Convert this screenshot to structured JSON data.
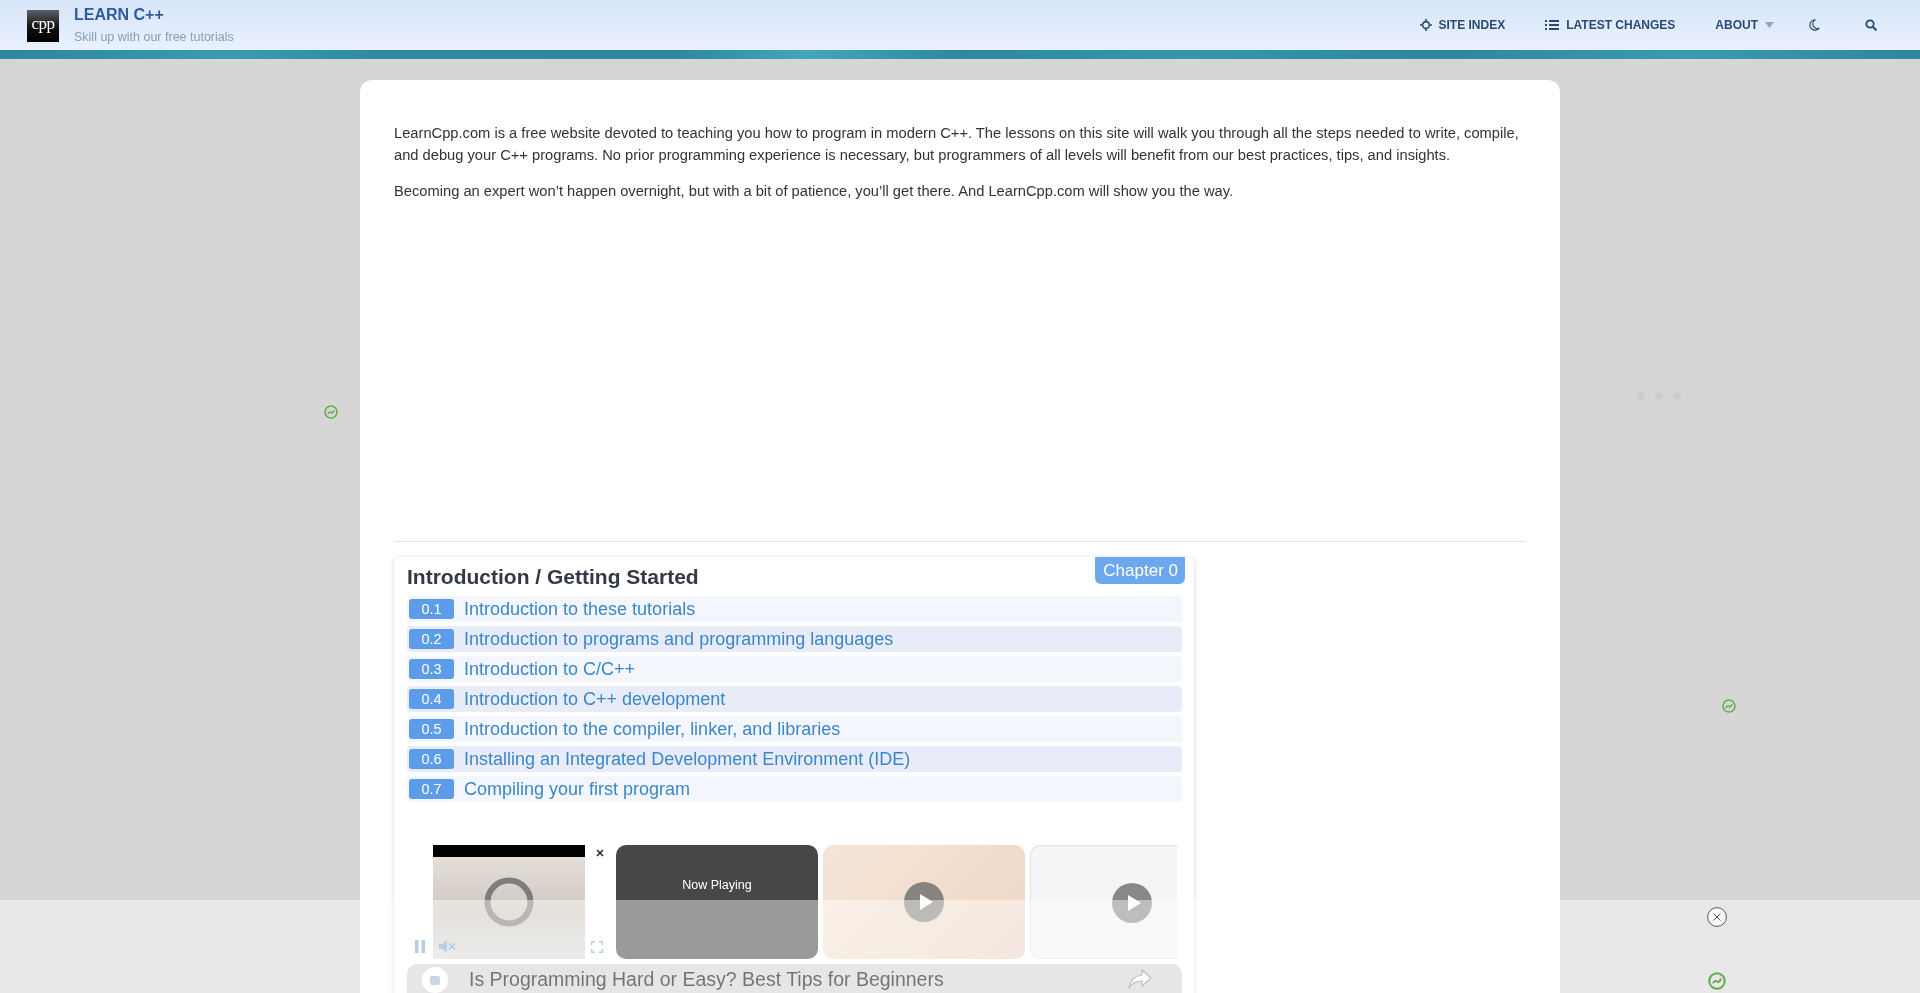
{
  "header": {
    "logo_text": "cpp",
    "title": "LEARN C++",
    "tagline": "Skill up with our free tutorials",
    "nav": [
      {
        "label": "SITE INDEX",
        "kind": "link"
      },
      {
        "label": "LATEST CHANGES",
        "kind": "link"
      },
      {
        "label": "ABOUT",
        "kind": "dropdown"
      }
    ]
  },
  "intro": {
    "paragraphs": [
      "LearnCpp.com is a free website devoted to teaching you how to program in modern C++. The lessons on this site will walk you through all the steps needed to write, compile, and debug your C++ programs. No prior programming experience is necessary, but programmers of all levels will benefit from our best practices, tips, and insights.",
      "Becoming an expert won’t happen overnight, but with a bit of patience, you’ll get there. And LearnCpp.com will show you the way."
    ]
  },
  "chapter": {
    "title": "Introduction / Getting Started",
    "badge": "Chapter 0",
    "lessons": [
      {
        "number": "0.1",
        "title": "Introduction to these tutorials"
      },
      {
        "number": "0.2",
        "title": "Introduction to programs and programming languages"
      },
      {
        "number": "0.3",
        "title": "Introduction to C/C++"
      },
      {
        "number": "0.4",
        "title": "Introduction to C++ development"
      },
      {
        "number": "0.5",
        "title": "Introduction to the compiler, linker, and libraries"
      },
      {
        "number": "0.6",
        "title": "Installing an Integrated Development Environment (IDE)"
      },
      {
        "number": "0.7",
        "title": "Compiling your first program"
      }
    ]
  },
  "video_player": {
    "playing": true,
    "muted": true,
    "now_playing": "Now Playing",
    "video_title": "Is Programming Hard or Easy? Best Tips for Beginners"
  }
}
